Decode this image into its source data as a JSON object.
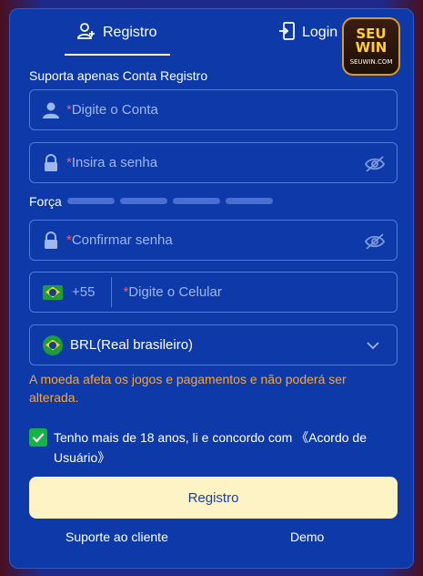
{
  "tabs": {
    "register_label": "Registro",
    "login_label": "Login"
  },
  "logo": {
    "line1": "SEU",
    "line2": "WIN",
    "line3": "SEUWIN.COM"
  },
  "caption": "Suporta apenas Conta Registro",
  "account": {
    "required_mark": "*",
    "placeholder": "Digite o Conta"
  },
  "password": {
    "required_mark": "*",
    "placeholder": "Insira a senha"
  },
  "strength": {
    "label": "Força",
    "bars": 4
  },
  "confirm": {
    "required_mark": "*",
    "placeholder": "Confirmar senha"
  },
  "phone": {
    "country_code": "+55",
    "required_mark": "*",
    "placeholder": "Digite o Celular"
  },
  "currency": {
    "value": "BRL(Real brasileiro)"
  },
  "warning": "A moeda afeta os jogos e pagamentos e não poderá ser alterada.",
  "agreement": {
    "checked": true,
    "text": "Tenho mais de 18 anos, li e concordo com",
    "link": "《Acordo de Usuário》"
  },
  "submit_label": "Registro",
  "footer": {
    "support": "Suporte ao cliente",
    "demo": "Demo"
  },
  "colors": {
    "panel": "#0d3aa8",
    "accent_button": "#fdf3c4",
    "warning": "#f3a63a",
    "checkbox": "#17b246",
    "required": "#ff5a5a"
  }
}
